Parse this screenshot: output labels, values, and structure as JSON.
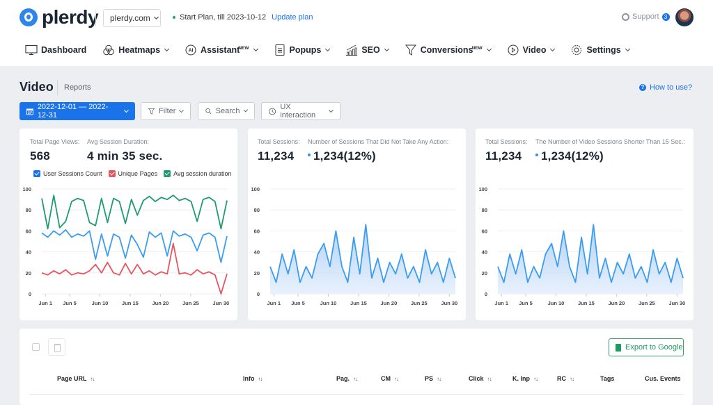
{
  "header": {
    "logo_text": "plerdy",
    "site_select": "plerdy.com",
    "plan_text": "Start Plan, till 2023-10-12",
    "plan_link": "Update plan",
    "support_label": "Support",
    "support_badge": "3",
    "avatar_icon": "user-avatar"
  },
  "nav": [
    {
      "label": "Dashboard",
      "icon": "monitor-icon",
      "new": "",
      "dropdown": false
    },
    {
      "label": "Heatmaps",
      "icon": "heatmap-circles-icon",
      "new": "",
      "dropdown": true
    },
    {
      "label": "Assistant",
      "icon": "ai-icon",
      "new": "NEW",
      "dropdown": true
    },
    {
      "label": "Popups",
      "icon": "document-icon",
      "new": "",
      "dropdown": true
    },
    {
      "label": "SEO",
      "icon": "bar-growth-icon",
      "new": "",
      "dropdown": true
    },
    {
      "label": "Conversions",
      "icon": "funnel-icon",
      "new": "NEW",
      "dropdown": true
    },
    {
      "label": "Video",
      "icon": "play-circle-icon",
      "new": "",
      "dropdown": true
    },
    {
      "label": "Settings",
      "icon": "gear-icon",
      "new": "",
      "dropdown": true
    }
  ],
  "page": {
    "title": "Video",
    "subtitle": "Reports",
    "how_to": "How to use?",
    "how_to_icon": "?"
  },
  "toolbar": {
    "date_range": "2022-12-01 — 2022-12-31",
    "filter": "Filter",
    "search": "Search",
    "ux": "UX interaction"
  },
  "cards": [
    {
      "stat1_label": "Total Page Views:",
      "stat1_value": "568",
      "stat2_label": "Avg Session Duration:",
      "stat2_value": "4 min 35 sec."
    },
    {
      "stat1_label": "Total Sessions:",
      "stat1_value": "11,234",
      "stat2_label": "Number of Sessions That Did Not Take Any Action:",
      "stat2_value": "1,234(12%)"
    },
    {
      "stat1_label": "Total Sessions:",
      "stat1_value": "11,234",
      "stat2_label": "The Number of Video Sessions Shorter Than 15 Sec.:",
      "stat2_value": "1,234(12%)"
    }
  ],
  "colors": {
    "primary": "#1a73e8",
    "blue_series": "#3b9cf0",
    "red_series": "#e5555f",
    "green_series": "#1f9a72",
    "area_fill": "#cfe3fb"
  },
  "chart_data": [
    {
      "type": "line",
      "title": "",
      "legend": [
        "User Sessions Count",
        "Unique Pages",
        "Avg session duration"
      ],
      "legend_placement": "top",
      "ylim": [
        0,
        100
      ],
      "yticks": [
        "0",
        "20",
        "40",
        "60",
        "80",
        "100"
      ],
      "xticks": [
        "Jun 1",
        "Jun 5",
        "Jun 10",
        "Jun 15",
        "Jun 20",
        "Jun 25",
        "Jun 30"
      ],
      "x_start_day": 0.4,
      "x_end_day": 31.0,
      "grid": true,
      "series": [
        {
          "name": "Avg session duration",
          "color": "#1f9a72",
          "values": [
            91,
            62,
            94,
            63,
            69,
            88,
            91,
            89,
            68,
            65,
            91,
            68,
            91,
            88,
            67,
            90,
            75,
            89,
            93,
            88,
            92,
            90,
            94,
            89,
            91,
            88,
            69,
            90,
            92,
            88,
            62,
            89
          ]
        },
        {
          "name": "User Sessions Count",
          "color": "#3b9cf0",
          "values": [
            58,
            54,
            60,
            56,
            61,
            54,
            57,
            55,
            60,
            33,
            57,
            36,
            57,
            54,
            34,
            56,
            47,
            35,
            59,
            54,
            58,
            36,
            60,
            55,
            57,
            54,
            41,
            56,
            58,
            54,
            30,
            55
          ]
        },
        {
          "name": "Unique Pages",
          "color": "#e5555f",
          "values": [
            20,
            18,
            22,
            19,
            23,
            18,
            20,
            19,
            22,
            28,
            20,
            30,
            20,
            18,
            29,
            19,
            28,
            19,
            22,
            18,
            21,
            19,
            48,
            19,
            20,
            18,
            23,
            19,
            21,
            18,
            0,
            19
          ]
        }
      ]
    },
    {
      "type": "area",
      "title": "",
      "ylim": [
        0,
        100
      ],
      "yticks": [
        "0",
        "20",
        "40",
        "60",
        "80",
        "100"
      ],
      "xticks": [
        "Jun 1",
        "Jun 5",
        "Jun 10",
        "Jun 15",
        "Jun 20",
        "Jun 25",
        "Jun 30"
      ],
      "x_start_day": 0.4,
      "x_end_day": 31.0,
      "grid": true,
      "series": [
        {
          "name": "Sessions without action",
          "color": "#3b9cf0",
          "values": [
            26,
            11,
            38,
            19,
            42,
            11,
            26,
            15,
            38,
            48,
            26,
            60,
            26,
            11,
            54,
            19,
            66,
            15,
            34,
            11,
            30,
            19,
            38,
            15,
            26,
            11,
            42,
            19,
            30,
            11,
            34,
            15
          ]
        }
      ]
    },
    {
      "type": "area",
      "title": "",
      "ylim": [
        0,
        100
      ],
      "yticks": [
        "0",
        "20",
        "40",
        "60",
        "80",
        "100"
      ],
      "xticks": [
        "Jun 1",
        "Jun 5",
        "Jun 10",
        "Jun 15",
        "Jun 20",
        "Jun 25",
        "Jun 30"
      ],
      "x_start_day": 0.4,
      "x_end_day": 31.0,
      "grid": true,
      "series": [
        {
          "name": "Video sessions shorter than 15 sec",
          "color": "#3b9cf0",
          "values": [
            26,
            11,
            38,
            19,
            42,
            11,
            26,
            15,
            38,
            48,
            26,
            60,
            26,
            11,
            54,
            19,
            66,
            15,
            34,
            11,
            30,
            19,
            38,
            15,
            26,
            11,
            42,
            19,
            30,
            11,
            34,
            15
          ]
        }
      ]
    }
  ],
  "table": {
    "export_label": "Export to Google",
    "columns": [
      {
        "label": "Page URL",
        "sortable": true
      },
      {
        "label": "Info",
        "sortable": true
      },
      {
        "label": "Pag.",
        "sortable": true
      },
      {
        "label": "CM",
        "sortable": true
      },
      {
        "label": "PS",
        "sortable": true
      },
      {
        "label": "Click",
        "sortable": true
      },
      {
        "label": "K. Inp",
        "sortable": true
      },
      {
        "label": "RC",
        "sortable": true
      },
      {
        "label": "Tags",
        "sortable": false
      },
      {
        "label": "Cus. Events",
        "sortable": false
      }
    ],
    "sort_glyph": "↑↓"
  }
}
